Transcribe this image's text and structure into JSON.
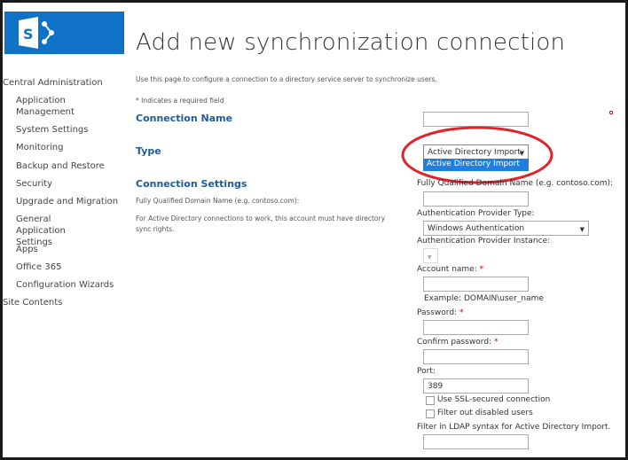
{
  "title": "Add new synchronization connection",
  "intro": "Use this page to configure a connection to a directory service server to synchronize users.",
  "required_note": "* Indicates a required field",
  "nav": {
    "root": "Central Administration",
    "items": [
      "Application Management",
      "System Settings",
      "Monitoring",
      "Backup and Restore",
      "Security",
      "Upgrade and Migration",
      "General Application Settings",
      "Apps",
      "Office 365",
      "Configuration Wizards"
    ],
    "site_contents": "Site Contents"
  },
  "sections": {
    "connection_name": "Connection Name",
    "type": "Type",
    "connection_settings": "Connection Settings",
    "fqdn_desc": "Fully Qualified Domain Name (e.g. contoso.com):",
    "ad_desc": "For Active Directory connections to work, this account must have directory sync rights."
  },
  "form": {
    "type_value": "Active Directory Import",
    "type_option": "Active Directory Import",
    "fqdn_label": "Fully Qualified Domain Name (e.g. contoso.com):",
    "auth_type_label": "Authentication Provider Type:",
    "auth_type_value": "Windows Authentication",
    "auth_instance_label": "Authentication Provider Instance:",
    "account_label": "Account name:",
    "account_example": "Example: DOMAIN\\user_name",
    "password_label": "Password:",
    "confirm_label": "Confirm password:",
    "port_label": "Port:",
    "port_value": "389",
    "ssl_label": "Use SSL-secured connection",
    "filter_disabled_label": "Filter out disabled users",
    "ldap_label": "Filter in LDAP syntax for Active Directory Import.",
    "req": "*"
  },
  "colors": {
    "accent": "#0f72c6",
    "highlight": "#e0242a"
  }
}
